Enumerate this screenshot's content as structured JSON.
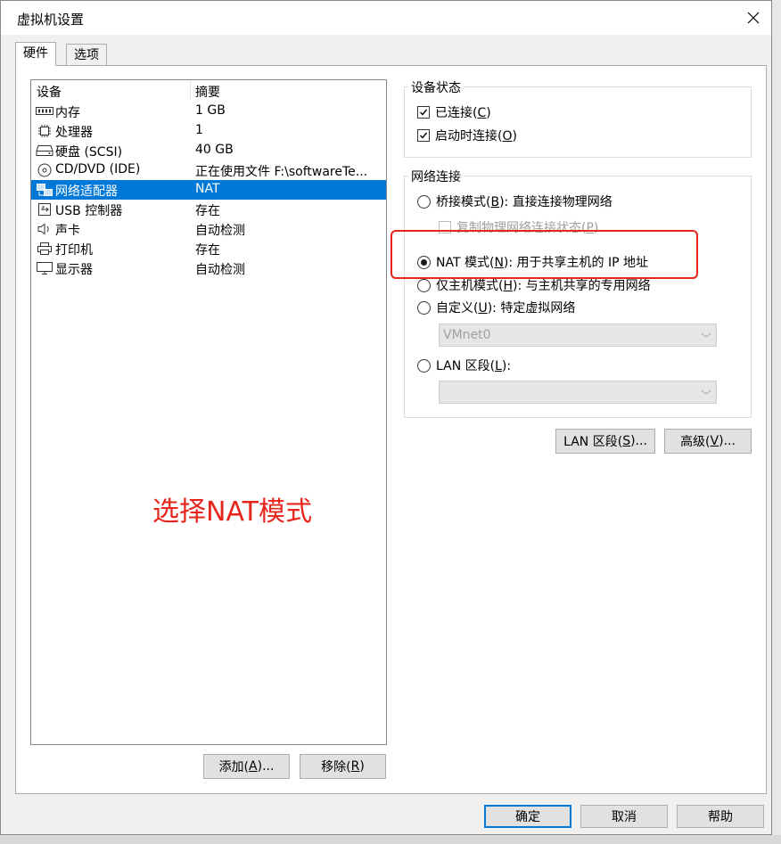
{
  "window": {
    "title": "虚拟机设置"
  },
  "tabs": [
    {
      "label": "硬件",
      "active": true
    },
    {
      "label": "选项",
      "active": false
    }
  ],
  "device_list": {
    "columns": [
      "设备",
      "摘要"
    ],
    "rows": [
      {
        "name": "内存",
        "summary": "1 GB",
        "icon": "memory-icon"
      },
      {
        "name": "处理器",
        "summary": "1",
        "icon": "cpu-icon"
      },
      {
        "name": "硬盘 (SCSI)",
        "summary": "40 GB",
        "icon": "harddisk-icon"
      },
      {
        "name": "CD/DVD (IDE)",
        "summary": "正在使用文件 F:\\softwareTe...",
        "icon": "cdrom-icon"
      },
      {
        "name": "网络适配器",
        "summary": "NAT",
        "icon": "network-adapter-icon",
        "selected": true
      },
      {
        "name": "USB 控制器",
        "summary": "存在",
        "icon": "usb-icon"
      },
      {
        "name": "声卡",
        "summary": "自动检测",
        "icon": "speaker-icon"
      },
      {
        "name": "打印机",
        "summary": "存在",
        "icon": "printer-icon"
      },
      {
        "name": "显示器",
        "summary": "自动检测",
        "icon": "monitor-icon"
      }
    ]
  },
  "annotation": {
    "text": "选择NAT模式",
    "color": "#e8251c"
  },
  "list_buttons": {
    "add": {
      "pre": "添加(",
      "key": "A",
      "post": ")..."
    },
    "remove": {
      "pre": "移除(",
      "key": "R",
      "post": ")"
    }
  },
  "device_status": {
    "title": "设备状态",
    "connected": {
      "pre": "已连接(",
      "key": "C",
      "post": ")",
      "checked": true
    },
    "connect_at_power_on": {
      "pre": "启动时连接(",
      "key": "O",
      "post": ")",
      "checked": true
    }
  },
  "network_connection": {
    "title": "网络连接",
    "bridged": {
      "pre": "桥接模式(",
      "key": "B",
      "post": "): 直接连接物理网络",
      "checked": false
    },
    "replicate": {
      "pre": "复制物理网络连接状态(",
      "key": "P",
      "post": ")",
      "checked": false
    },
    "nat": {
      "pre": "NAT 模式(",
      "key": "N",
      "post": "): 用于共享主机的 IP 地址",
      "checked": true
    },
    "host_only": {
      "pre": "仅主机模式(",
      "key": "H",
      "post": "): 与主机共享的专用网络",
      "checked": false
    },
    "custom": {
      "pre": "自定义(",
      "key": "U",
      "post": "): 特定虚拟网络",
      "checked": false
    },
    "custom_select": {
      "value": "VMnet0"
    },
    "lan": {
      "pre": "LAN 区段(",
      "key": "L",
      "post": "):",
      "checked": false
    },
    "lan_select": {
      "value": ""
    }
  },
  "network_buttons": {
    "lan_segments": {
      "pre": "LAN 区段(",
      "key": "S",
      "post": ")..."
    },
    "advanced": {
      "pre": "高级(",
      "key": "V",
      "post": ")..."
    }
  },
  "dialog_buttons": {
    "ok": "确定",
    "cancel": "取消",
    "help": "帮助"
  },
  "colors": {
    "selection": "#0078d7",
    "annotation": "#e8251c",
    "window_bg": "#f0f0f0"
  }
}
